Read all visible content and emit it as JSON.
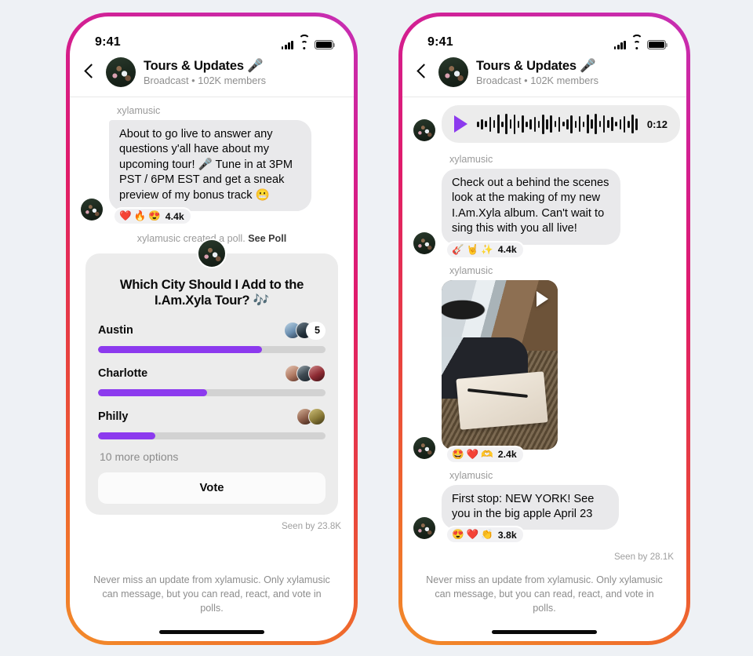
{
  "background_color": "#eef1f5",
  "frame_gradient": [
    "#f28b2a",
    "#e01b6a",
    "#c62fb4"
  ],
  "accent_color": "#8c3aee",
  "status_bar": {
    "time": "9:41",
    "signal_icon": "cellular-bars-icon",
    "wifi_icon": "wifi-icon",
    "battery_icon": "battery-full-icon"
  },
  "header": {
    "back_icon": "back-chevron-icon",
    "avatar_icon": "broadcast-avatar",
    "title": "Tours & Updates 🎤",
    "subtitle": "Broadcast • 102K members"
  },
  "footer_note": "Never miss an update from xylamusic. Only xylamusic can message, but you can read, react, and vote in polls.",
  "left_phone": {
    "messages": [
      {
        "sender": "xylamusic",
        "text": "About to go live to answer any questions y'all have about my upcoming tour! 🎤 Tune in at 3PM PST / 6PM EST and get a sneak preview of my bonus track 😬",
        "reactions": [
          "❤️",
          "🔥",
          "😍"
        ],
        "reaction_count": "4.4k"
      }
    ],
    "poll_note_prefix": "xylamusic created a poll.",
    "poll_note_link": "See Poll",
    "poll": {
      "question": "Which City Should I Add to the I.Am.Xyla Tour? 🎶",
      "options": [
        {
          "label": "Austin",
          "percent": 72,
          "voters": 2,
          "count": "5"
        },
        {
          "label": "Charlotte",
          "percent": 48,
          "voters": 3,
          "count": ""
        },
        {
          "label": "Philly",
          "percent": 25,
          "voters": 2,
          "count": ""
        }
      ],
      "more_options": "10 more options",
      "vote_button": "Vote"
    },
    "seen_by": "Seen by 23.8K"
  },
  "right_phone": {
    "voice_note": {
      "play_icon": "play-icon",
      "duration": "0:12",
      "waveform": [
        7,
        13,
        8,
        19,
        10,
        24,
        7,
        26,
        12,
        25,
        9,
        22,
        7,
        13,
        19,
        9,
        25,
        13,
        22,
        8,
        19,
        6,
        13,
        23,
        9,
        20,
        7,
        24,
        12,
        26,
        8,
        22,
        10,
        18,
        6,
        13,
        21,
        9,
        24,
        15
      ]
    },
    "messages": [
      {
        "sender": "xylamusic",
        "text": "Check out a behind the scenes look at the making of my new I.Am.Xyla album. Can't wait to sing this with you all live!",
        "reactions": [
          "🎸",
          "🤘",
          "✨"
        ],
        "reaction_count": "4.4k"
      },
      {
        "sender": "xylamusic",
        "type": "video",
        "video_play_icon": "play-icon",
        "reactions": [
          "🤩",
          "❤️",
          "🫶"
        ],
        "reaction_count": "2.4k"
      },
      {
        "sender": "xylamusic",
        "text": "First stop: NEW YORK! See you in the big apple April 23",
        "reactions": [
          "😍",
          "❤️",
          "👏"
        ],
        "reaction_count": "3.8k"
      }
    ],
    "seen_by": "Seen by 28.1K"
  }
}
